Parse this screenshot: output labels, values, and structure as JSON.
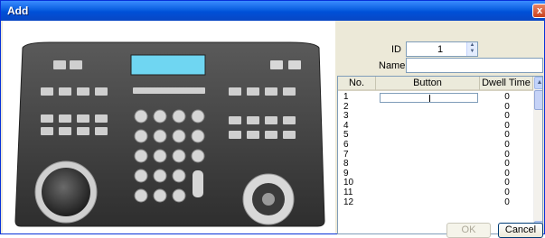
{
  "window": {
    "title": "Add",
    "close_glyph": "x"
  },
  "form": {
    "id_label": "ID",
    "id_value": "1",
    "name_label": "Name",
    "name_value": ""
  },
  "table": {
    "columns": [
      "No.",
      "Button",
      "Dwell Time"
    ],
    "rows": [
      {
        "no": "1",
        "button": "",
        "dwell": "0"
      },
      {
        "no": "2",
        "button": "",
        "dwell": "0"
      },
      {
        "no": "3",
        "button": "",
        "dwell": "0"
      },
      {
        "no": "4",
        "button": "",
        "dwell": "0"
      },
      {
        "no": "5",
        "button": "",
        "dwell": "0"
      },
      {
        "no": "6",
        "button": "",
        "dwell": "0"
      },
      {
        "no": "7",
        "button": "",
        "dwell": "0"
      },
      {
        "no": "8",
        "button": "",
        "dwell": "0"
      },
      {
        "no": "9",
        "button": "",
        "dwell": "0"
      },
      {
        "no": "10",
        "button": "",
        "dwell": "0"
      },
      {
        "no": "11",
        "button": "",
        "dwell": "0"
      },
      {
        "no": "12",
        "button": "",
        "dwell": "0"
      }
    ]
  },
  "actions": {
    "ok_label": "OK",
    "cancel_label": "Cancel"
  },
  "colors": {
    "titlebar": "#0a5fe0",
    "dialog_bg": "#ece9d8",
    "keyboard_body": "#3a3a3a",
    "lcd": "#6fd6f2"
  }
}
